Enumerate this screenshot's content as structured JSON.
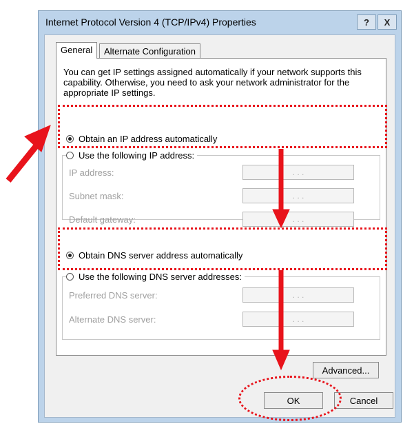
{
  "window": {
    "title": "Internet Protocol Version 4 (TCP/IPv4) Properties",
    "help_label": "?",
    "close_label": "X"
  },
  "tabs": [
    {
      "label": "General",
      "active": true
    },
    {
      "label": "Alternate Configuration",
      "active": false
    }
  ],
  "description": "You can get IP settings assigned automatically if your network supports this capability. Otherwise, you need to ask your network administrator for the appropriate IP settings.",
  "ip_section": {
    "auto_label": "Obtain an IP address automatically",
    "auto_selected": true,
    "manual_label": "Use the following IP address:",
    "fields": [
      {
        "label": "IP address:",
        "value": " .  .  . "
      },
      {
        "label": "Subnet mask:",
        "value": " .  .  . "
      },
      {
        "label": "Default gateway:",
        "value": " .  .  . "
      }
    ]
  },
  "dns_section": {
    "auto_label": "Obtain DNS server address automatically",
    "auto_selected": true,
    "manual_label": "Use the following DNS server addresses:",
    "fields": [
      {
        "label": "Preferred DNS server:",
        "value": " .  .  . "
      },
      {
        "label": "Alternate DNS server:",
        "value": " .  .  . "
      }
    ]
  },
  "buttons": {
    "advanced": "Advanced...",
    "ok": "OK",
    "cancel": "Cancel"
  },
  "annotation_color": "#e8131b"
}
